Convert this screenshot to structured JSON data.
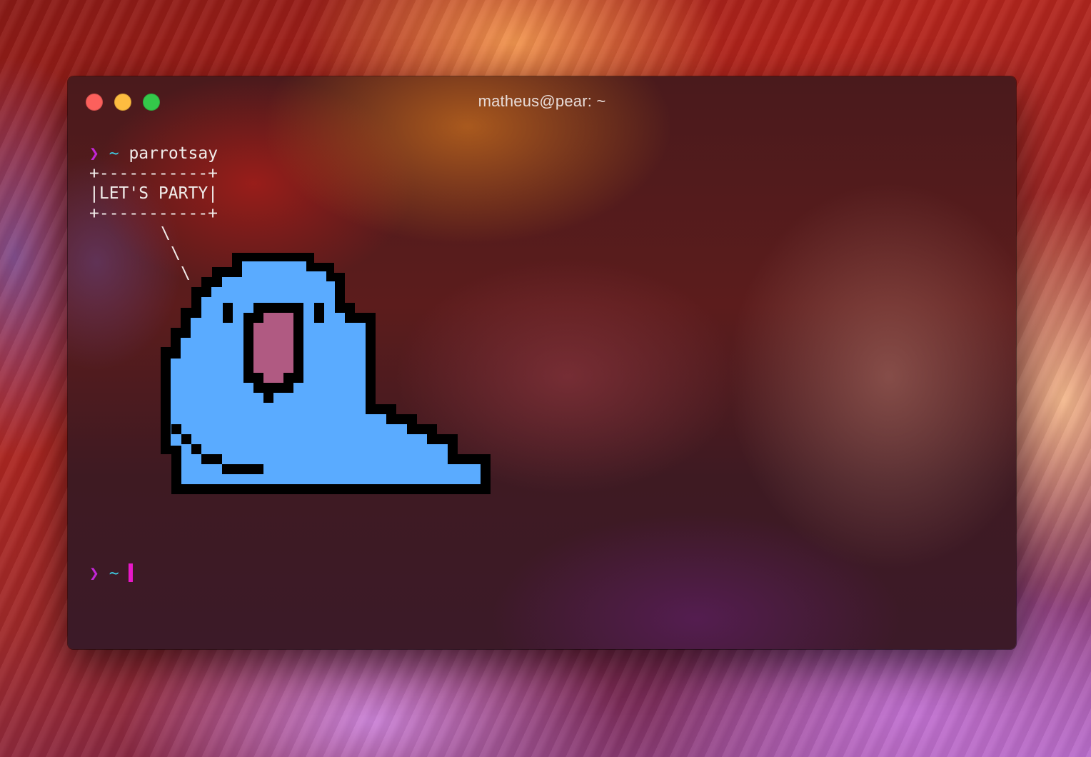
{
  "window": {
    "title": "matheus@pear: ~"
  },
  "terminal": {
    "prompt_symbol": "❯",
    "cwd": "~",
    "command": "parrotsay",
    "bubble_top": "+-----------+",
    "bubble_text": "|LET'S PARTY|",
    "bubble_bottom": "+-----------+",
    "tail_char": "\\",
    "colors": {
      "prompt_arrow": "#c226d6",
      "prompt_tilde": "#3ecfe6",
      "cursor": "#e818c8",
      "parrot_body": "#5aabff",
      "parrot_beak": "#b05a82",
      "parrot_outline": "#000000"
    }
  },
  "icons": [
    "close-button",
    "minimize-button",
    "zoom-button",
    "parrot-ascii-art"
  ]
}
